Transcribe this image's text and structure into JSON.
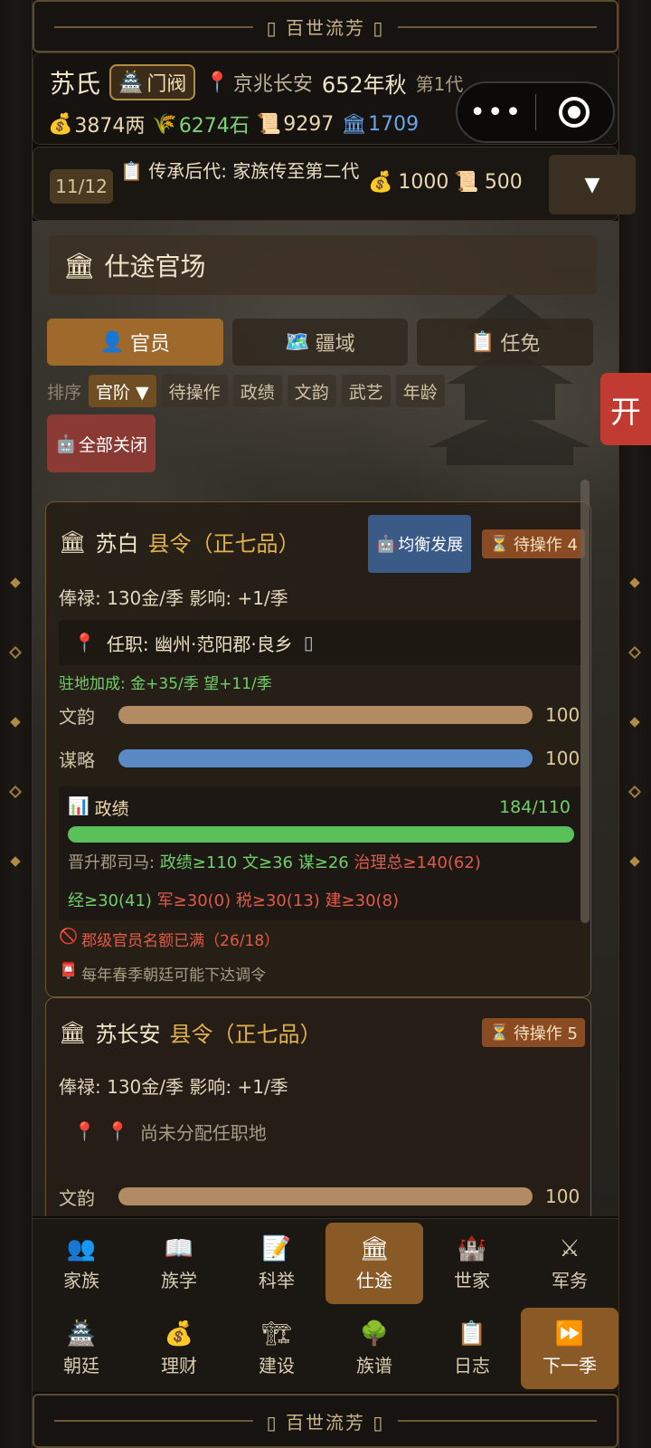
{
  "banner": {
    "title": "百世流芳"
  },
  "header": {
    "clan": "苏氏",
    "rank": "门阀",
    "location": "京兆长安",
    "year": "652年秋",
    "generation": "第1代",
    "resources": {
      "silver": "3874两",
      "grain": "6274石",
      "scrolls": "9297",
      "prestige": "1709"
    }
  },
  "task": {
    "progress": "11/12",
    "text": "传承后代: 家族传至第二代",
    "cost_silver": "1000",
    "cost_scroll": "500",
    "dropdown": "▼"
  },
  "section": {
    "title": "仕途官场"
  },
  "tabs": [
    {
      "icon": "👤",
      "label": "官员"
    },
    {
      "icon": "🗺️",
      "label": "疆域"
    },
    {
      "icon": "📋",
      "label": "任免"
    }
  ],
  "sort": {
    "label": "排序",
    "options": [
      "官阶 ▼",
      "待操作",
      "政绩",
      "文韵",
      "武艺",
      "年龄"
    ],
    "close_all": "全部关闭"
  },
  "side_tab": "开",
  "officials": [
    {
      "name": "苏白",
      "title": "县令（正七品）",
      "balance_btn": "均衡发展",
      "pending": "待操作 4",
      "salary": "俸禄: 130金/季   影响: +1/季",
      "post": "任职: 幽州·范阳郡·良乡",
      "bonus": "驻地加成: 金+35/季  望+11/季",
      "stats": [
        {
          "label": "文韵",
          "value": "100",
          "level": 1.0,
          "color": "#b38b62"
        },
        {
          "label": "谋略",
          "value": "100",
          "level": 1.0,
          "color": "#5a8ac6"
        }
      ],
      "performance": {
        "label": "政绩",
        "value": "184/110",
        "promo_label": "晋升郡司马:",
        "req1": "政绩≥110",
        "req2": "文≥36",
        "req3": "谋≥26",
        "req4": "治理总≥140(62)",
        "req5": "经≥30(41)",
        "req6": "军≥30(0)",
        "req7": "税≥30(13)",
        "req8": "建≥30(8)"
      },
      "warning": "郡级官员名额已满（26/18）",
      "notice": "每年春季朝廷可能下达调令"
    },
    {
      "name": "苏长安",
      "title": "县令（正七品）",
      "pending": "待操作 5",
      "salary": "俸禄: 130金/季   影响: +1/季",
      "post": "尚未分配任职地",
      "stat_label": "文韵",
      "stat_value": "100"
    }
  ],
  "nav": {
    "row1": [
      {
        "icon": "👥",
        "label": "家族"
      },
      {
        "icon": "📖",
        "label": "族学"
      },
      {
        "icon": "📝",
        "label": "科举"
      },
      {
        "icon": "🏛",
        "label": "仕途"
      },
      {
        "icon": "🏰",
        "label": "世家"
      },
      {
        "icon": "⚔",
        "label": "军务"
      }
    ],
    "row2": [
      {
        "icon": "🏯",
        "label": "朝廷"
      },
      {
        "icon": "💰",
        "label": "理财"
      },
      {
        "icon": "🏗",
        "label": "建设"
      },
      {
        "icon": "🌳",
        "label": "族谱"
      },
      {
        "icon": "📋",
        "label": "日志"
      },
      {
        "icon": "⏩",
        "label": "下一季"
      }
    ]
  }
}
